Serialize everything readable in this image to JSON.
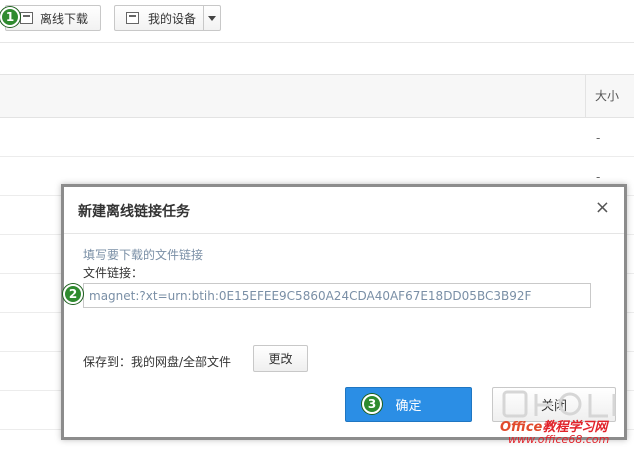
{
  "toolbar": {
    "offline_download_label": "离线下载",
    "my_devices_label": "我的设备"
  },
  "list": {
    "col_size_label": "大小",
    "rows": [
      {
        "size": "-"
      },
      {
        "size": "-"
      }
    ]
  },
  "dialog": {
    "title": "新建离线链接任务",
    "close_symbol": "×",
    "hint": "填写要下载的文件链接",
    "field_label": "文件链接：",
    "link_value": "magnet:?xt=urn:btih:0E15EFEE9C5860A24CDA40AF67E18DD05BC3B92F",
    "save_to_label": "保存到：我的网盘/全部文件",
    "change_label": "更改",
    "ok_label": "确定",
    "close_label": "关闭"
  },
  "badges": [
    "1",
    "2",
    "3"
  ],
  "watermark": {
    "brand_part1": "Office",
    "brand_part2": "教程学习网",
    "url": "www.office68.com"
  },
  "colors": {
    "accent": "#2b8ee5",
    "badge": "#2f8b2f",
    "hint": "#7a8fa6"
  }
}
